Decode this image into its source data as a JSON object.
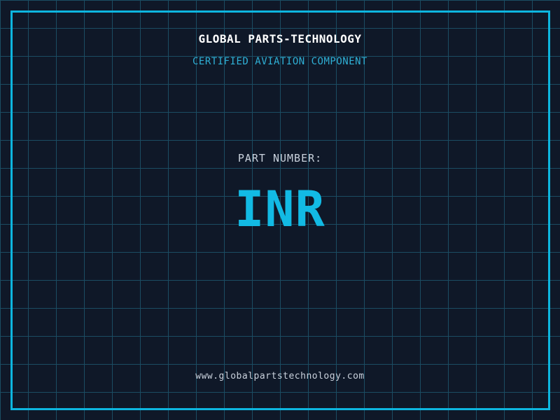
{
  "page": {
    "background_color": "#0f1828",
    "grid_color": "#1b4d63",
    "frame_color": "#0db5df"
  },
  "header": {
    "company_name": "GLOBAL PARTS-TECHNOLOGY",
    "subtitle": "CERTIFIED AVIATION COMPONENT",
    "subtitle_color": "#2fb0d6",
    "company_color": "#ffffff"
  },
  "part": {
    "label": "PART NUMBER:",
    "number": "INR",
    "number_color": "#12bae4",
    "label_color": "#c9d1dc"
  },
  "footer": {
    "website": "www.globalpartstechnology.com",
    "website_color": "#c9d1dc"
  }
}
